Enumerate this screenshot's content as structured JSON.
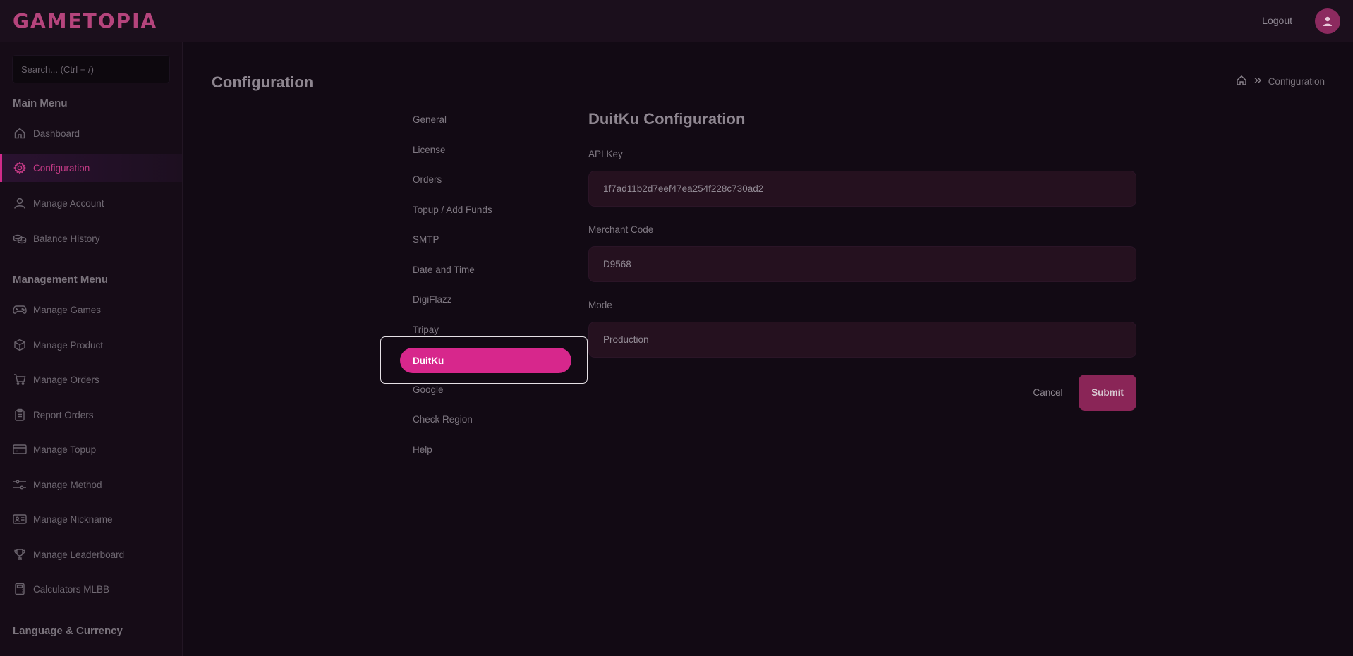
{
  "brand": {
    "logo_text": "GAMETOPIA",
    "accent": "#d7278c"
  },
  "header": {
    "logout_label": "Logout"
  },
  "sidebar": {
    "search_placeholder": "Search... (Ctrl + /)",
    "main_menu_title": "Main Menu",
    "main_items": [
      {
        "label": "Dashboard",
        "icon": "home-icon"
      },
      {
        "label": "Configuration",
        "icon": "gear-icon"
      },
      {
        "label": "Manage Account",
        "icon": "user-icon"
      },
      {
        "label": "Balance History",
        "icon": "coins-icon"
      }
    ],
    "management_menu_title": "Management Menu",
    "management_items": [
      {
        "label": "Manage Games",
        "icon": "gamepad-icon"
      },
      {
        "label": "Manage Product",
        "icon": "box-icon"
      },
      {
        "label": "Manage Orders",
        "icon": "cart-icon"
      },
      {
        "label": "Report Orders",
        "icon": "clipboard-icon"
      },
      {
        "label": "Manage Topup",
        "icon": "card-icon"
      },
      {
        "label": "Manage Method",
        "icon": "sliders-icon"
      },
      {
        "label": "Manage Nickname",
        "icon": "id-card-icon"
      },
      {
        "label": "Manage Leaderboard",
        "icon": "trophy-icon"
      },
      {
        "label": "Calculators MLBB",
        "icon": "calculator-icon"
      }
    ],
    "language_currency_title": "Language & Currency"
  },
  "page": {
    "title": "Configuration",
    "breadcrumb_current": "Configuration"
  },
  "config_menu": [
    "General",
    "License",
    "Orders",
    "Topup / Add Funds",
    "SMTP",
    "Date and Time",
    "DigiFlazz",
    "Tripay",
    "DuitKu",
    "Google",
    "Check Region",
    "Help"
  ],
  "config_menu_active": "DuitKu",
  "form": {
    "title": "DuitKu Configuration",
    "api_key_label": "API Key",
    "api_key_value": "1f7ad11b2d7eef47ea254f228c730ad2",
    "merchant_code_label": "Merchant Code",
    "merchant_code_value": "D9568",
    "mode_label": "Mode",
    "mode_value": "Production",
    "cancel_label": "Cancel",
    "submit_label": "Submit"
  }
}
